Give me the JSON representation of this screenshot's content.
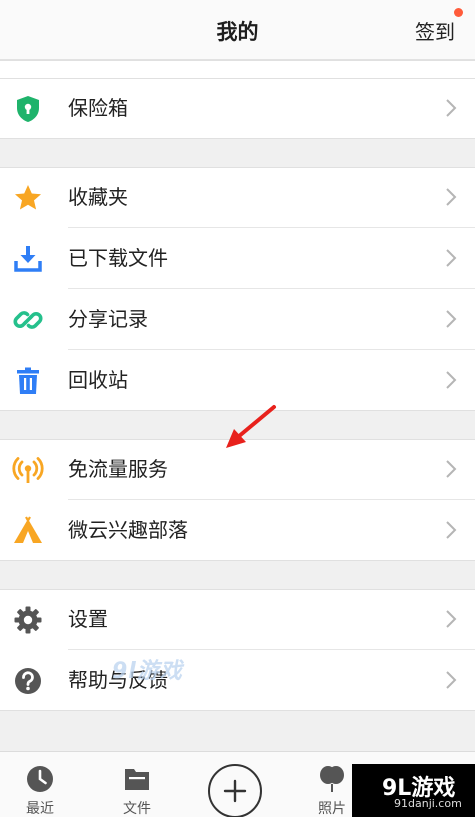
{
  "header": {
    "title": "我的",
    "checkin_label": "签到"
  },
  "menu": {
    "safe": "保险箱",
    "favorites": "收藏夹",
    "downloads": "已下载文件",
    "share_history": "分享记录",
    "recycle_bin": "回收站",
    "free_traffic": "免流量服务",
    "interest_tribe": "微云兴趣部落",
    "settings": "设置",
    "help_feedback": "帮助与反馈"
  },
  "tabbar": {
    "recent": "最近",
    "files": "文件",
    "photos": "照片"
  },
  "watermark": {
    "mid_text": "9l游戏",
    "badge_main": "9L游戏",
    "badge_sub": "91danji.com"
  },
  "colors": {
    "safe_icon": "#1fb36b",
    "star_icon": "#f8a623",
    "download_icon": "#2f7ef6",
    "link_icon": "#25c08c",
    "trash_icon": "#2f7ef6",
    "signal_icon": "#f8a623",
    "tent_icon": "#f8a623",
    "gear_icon": "#555555",
    "help_icon": "#555555",
    "notification_dot": "#ff5b3a",
    "annotation_arrow": "#e8211c"
  }
}
